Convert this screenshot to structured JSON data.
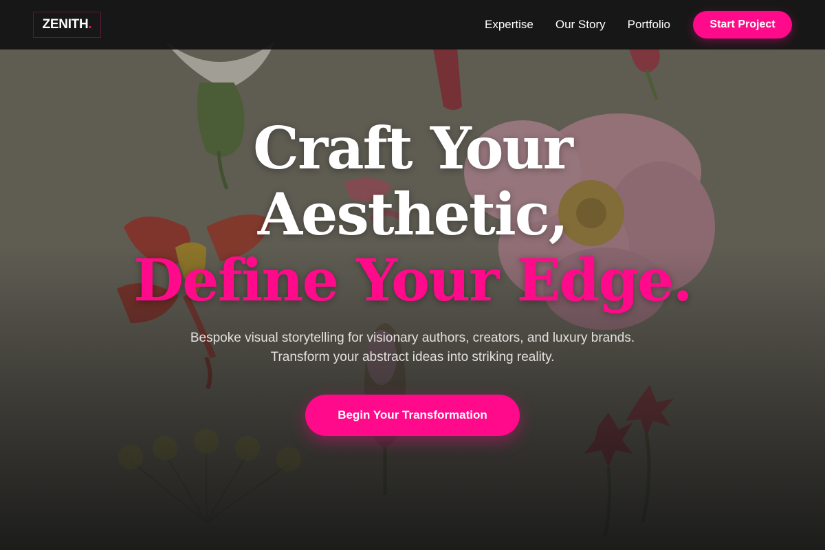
{
  "brand": {
    "name": "ZENITH",
    "dot": "."
  },
  "nav": {
    "links": [
      "Expertise",
      "Our Story",
      "Portfolio"
    ],
    "cta_label": "Start Project"
  },
  "hero": {
    "headline_line1": "Craft Your",
    "headline_line2": "Aesthetic,",
    "headline_accent": "Define Your Edge.",
    "subtext": "Bespoke visual storytelling for visionary authors, creators, and luxury brands. Transform your abstract ideas into striking reality.",
    "cta_label": "Begin Your Transformation",
    "background_image": "botanical-flowers-illustration"
  },
  "colors": {
    "accent": "#ff0a8a",
    "navbar_bg": "#121212",
    "text_light": "#ffffff"
  }
}
